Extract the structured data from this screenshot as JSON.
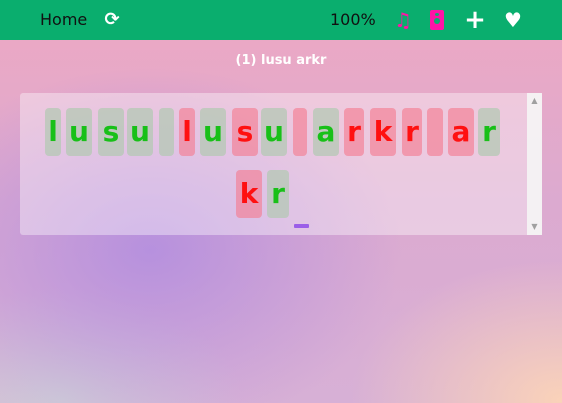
{
  "toolbar": {
    "home_label": "Home",
    "zoom_label": "100%",
    "icons": {
      "refresh": "refresh-icon",
      "music": "music-icon",
      "speaker": "speaker-icon",
      "add": "plus-icon",
      "favorite": "heart-icon"
    }
  },
  "lesson": {
    "title": "(1) lusu arkr"
  },
  "typing": {
    "row1": [
      {
        "char": "l",
        "status": "correct"
      },
      {
        "char": "u",
        "status": "correct"
      },
      {
        "char": "s",
        "status": "correct"
      },
      {
        "char": "u",
        "status": "correct"
      },
      {
        "char": " ",
        "status": "correct"
      },
      {
        "char": "l",
        "status": "wrong"
      },
      {
        "char": "u",
        "status": "correct"
      },
      {
        "char": "s",
        "status": "wrong"
      },
      {
        "char": "u",
        "status": "correct"
      },
      {
        "char": " ",
        "status": "wrong"
      },
      {
        "char": "a",
        "status": "correct"
      },
      {
        "char": "r",
        "status": "wrong"
      },
      {
        "char": "k",
        "status": "wrong"
      },
      {
        "char": "r",
        "status": "wrong"
      },
      {
        "char": " ",
        "status": "wrong"
      },
      {
        "char": "a",
        "status": "wrong"
      },
      {
        "char": "r",
        "status": "correct"
      }
    ],
    "row2": [
      {
        "char": "k",
        "status": "wrong"
      },
      {
        "char": "r",
        "status": "correct"
      }
    ]
  },
  "colors": {
    "topbar": "#0aae6e",
    "correct_text": "#18c018",
    "wrong_text": "#ff1010",
    "icon_pink": "#ff14a6",
    "cursor": "#9b5fe8"
  }
}
